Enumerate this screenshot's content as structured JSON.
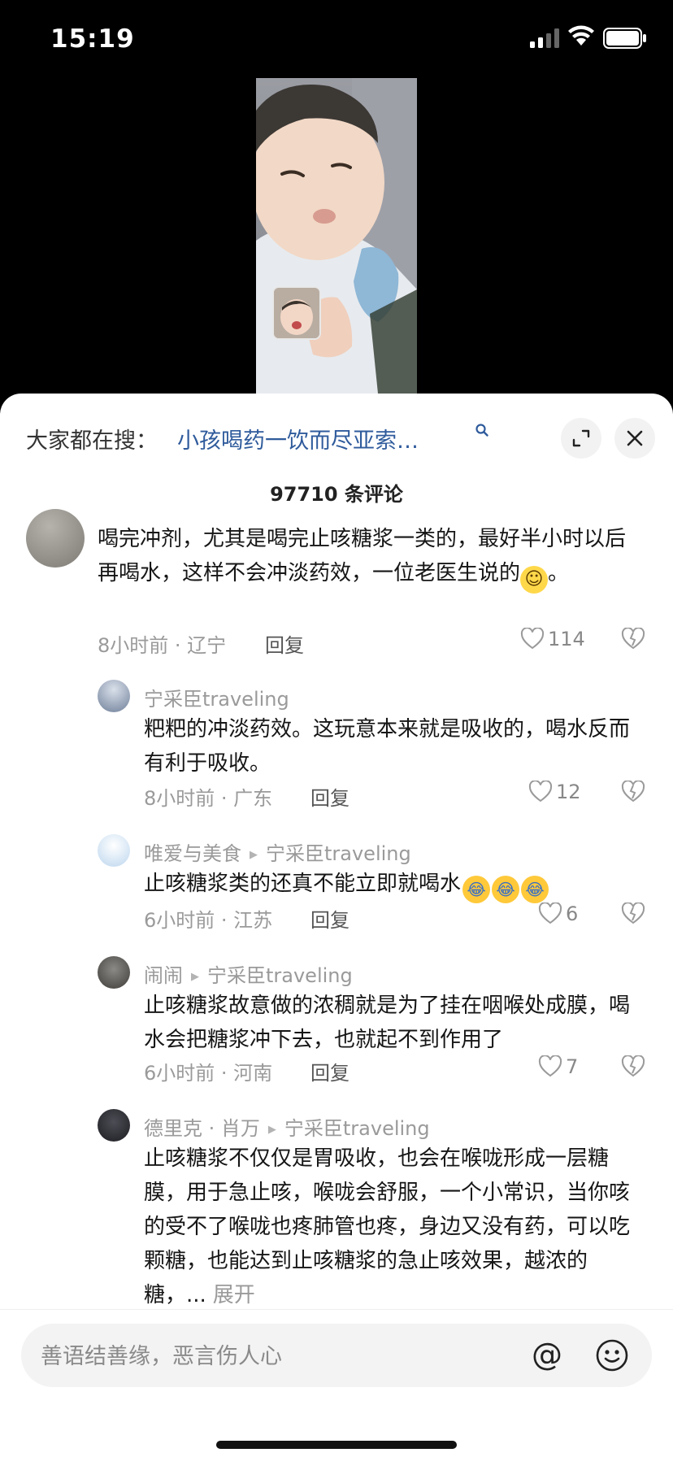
{
  "status_bar": {
    "time": "15:19"
  },
  "search": {
    "prefix": "大家都在搜：",
    "query": "小孩喝药一饮而尽亚索…"
  },
  "comments": {
    "count_label": "97710 条评论"
  },
  "main_comment": {
    "text": "喝完冲剂，尤其是喝完止咳糖浆一类的，最好半小时以后再喝水，这样不会冲淡药效，一位老医生说的",
    "tail": "。",
    "meta": "8小时前 · 辽宁",
    "reply_label": "回复",
    "likes": "114"
  },
  "replies": [
    {
      "author": "宁采臣traveling",
      "reply_to": "",
      "text": "粑粑的冲淡药效。这玩意本来就是吸收的，喝水反而有利于吸收。",
      "meta": "8小时前 · 广东",
      "reply_label": "回复",
      "likes": "12"
    },
    {
      "author": "唯爱与美食",
      "reply_to": "宁采臣traveling",
      "text": "止咳糖浆类的还真不能立即就喝水",
      "meta": "6小时前 · 江苏",
      "reply_label": "回复",
      "likes": "6"
    },
    {
      "author": "闹闹",
      "reply_to": "宁采臣traveling",
      "text": "止咳糖浆故意做的浓稠就是为了挂在咽喉处成膜，喝水会把糖浆冲下去，也就起不到作用了",
      "meta": "6小时前 · 河南",
      "reply_label": "回复",
      "likes": "7"
    },
    {
      "author": "德里克 · 肖万",
      "reply_to": "宁采臣traveling",
      "text": "止咳糖浆不仅仅是胃吸收，也会在喉咙形成一层糖膜，用于急止咳，喉咙会舒服，一个小常识，当你咳的受不了喉咙也疼肺管也疼，身边又没有药，可以吃颗糖，也能达到止咳糖浆的急止咳效果，越浓的糖，...",
      "more_label": "展开"
    }
  ],
  "input": {
    "placeholder": "善语结善缘，恶言伤人心"
  },
  "icons": {
    "at": "@",
    "emoji": "smile-face-icon",
    "expand": "expand-icon",
    "close": "close-icon",
    "search": "search-icon",
    "like": "heart-icon",
    "dislike": "broken-heart-icon"
  }
}
